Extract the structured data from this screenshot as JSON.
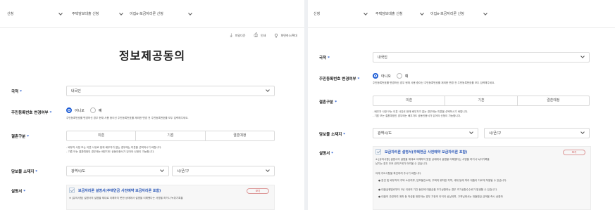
{
  "breadcrumb": {
    "items": [
      "신청",
      "주택담보대출 신청",
      "이집e-보금자리론 신청"
    ]
  },
  "toolbar": {
    "download_label": "파일다운",
    "print_label": "인쇄",
    "zoom_label": "화면축소/확대"
  },
  "page": {
    "title": "정보제공동의"
  },
  "form": {
    "nationality": {
      "label": "국적",
      "value": "내국인"
    },
    "resident_change": {
      "label": "주민등록번호 변경여부",
      "options": [
        "아니오",
        "예"
      ],
      "selected": "아니오",
      "note": "주민등록번호를 변경하신 경우 현재 사용 중이신 주민등록번호를 제외한 변경 전 주민등록번호를 모두 입력해주세요."
    },
    "marriage": {
      "label": "결혼구분",
      "options": [
        "미혼",
        "기혼",
        "결혼예정"
      ],
      "notes": [
        "- 배우자 사망 또는 이혼 사유로 현재 배우자가 없는 경우에는 미혼을 선택하시기 바랍니다.",
        "- 기혼 또는 결혼예정인 경우에는 배우자도 공동인증서가 있어야 신청이 가능합니다."
      ]
    },
    "collateral_location": {
      "label": "담보물 소재지",
      "city": "광역시/도",
      "district": "시/군/구"
    },
    "explanation": {
      "label": "설명서",
      "consent_title": "보금자리론 설명서(주택연금 사전예약 보금자리론 포함)",
      "view_label": "보기",
      "text1": "※ [유의사항] 설명서의 설명을 제대로 이해하지 못한 상태에서 설명을 이해했다는 서명을 하거나 녹취기록을",
      "text2": "남기는 경우 추후 권리구제가 어려울 수 있습니다.",
      "intro": "아래 주요사항을 확인하여 주시기 바랍니다.",
      "bullets": [
        "● 본인 및 배우자의 주택 소유여부, 담보물건소재, 주택의 위치한 지역, 세대 등에 따라 대출이 다르게 적용될 수 있습니다.",
        "● 대출실행일로부터 3년 이내의 기간 동안에 대출금을 조기상환하는 경우 조기상환수수료가 발생할 수 있습니다.",
        "● 대출의 관련하여 계좌 등 작성을 위반하는 경우 기한의 이익이 상실되며, 고객님께서는 대출원금 금액을 즉시 상환하"
      ]
    }
  },
  "colors": {
    "accent": "#1f5ed6",
    "link": "#2a57b8",
    "required": "#2a5fd0"
  }
}
